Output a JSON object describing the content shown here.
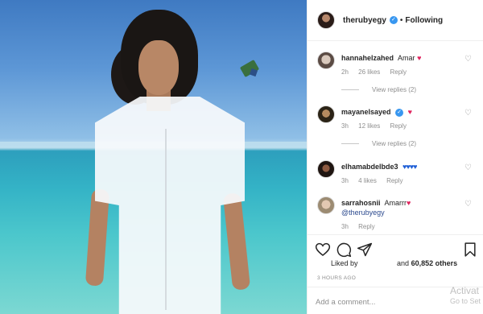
{
  "post": {
    "username": "therubyegy",
    "verified_mark": "✓",
    "separator": "•",
    "follow_label": "Following"
  },
  "comments": [
    {
      "user": "hannahelzahed",
      "text": "Amar",
      "emoji": "♥",
      "emoji_color": "#e0245e",
      "time": "2h",
      "likes": "26 likes",
      "reply": "Reply",
      "view_replies": "View replies (2)"
    },
    {
      "user": "mayanelsayed",
      "verified": "✓",
      "emoji": "♥",
      "emoji_color": "#e0245e",
      "time": "3h",
      "likes": "12 likes",
      "reply": "Reply",
      "view_replies": "View replies (2)"
    },
    {
      "user": "elhamabdelbde3",
      "emoji": "♥♥♥♥",
      "emoji_color": "#1f5fd6",
      "time": "3h",
      "likes": "4 likes",
      "reply": "Reply"
    },
    {
      "user": "sarrahosnii",
      "text": "Amarrr",
      "emoji": "♥",
      "emoji_color": "#e0245e",
      "mention": "@therubyegy",
      "time": "3h",
      "reply": "Reply"
    }
  ],
  "actions": {
    "like_icon": "heart-outline-icon",
    "comment_icon": "comment-bubble-icon",
    "share_icon": "paper-plane-icon",
    "save_icon": "bookmark-icon"
  },
  "likes_line": {
    "prefix": "Liked by",
    "suffix": "and",
    "count": "60,852 others"
  },
  "time_ago": "3 HOURS AGO",
  "add_comment_placeholder": "Add a comment...",
  "watermark": {
    "line1": "Activat",
    "line2": "Go to Set"
  }
}
